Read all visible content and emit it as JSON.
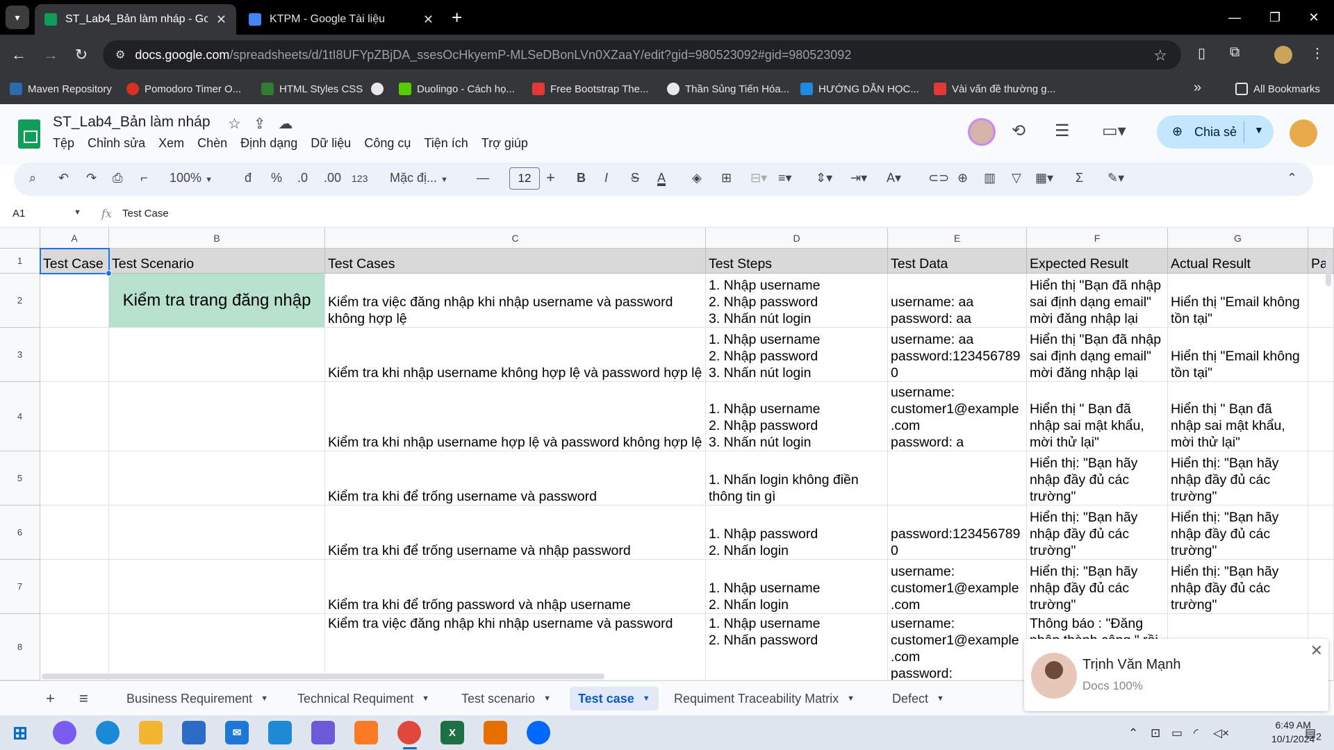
{
  "browser": {
    "tabs": [
      {
        "title": "ST_Lab4_Bản làm nháp - Google",
        "active": true
      },
      {
        "title": "KTPM - Google Tài liệu",
        "active": false
      }
    ],
    "url_host": "docs.google.com",
    "url_path": "/spreadsheets/d/1tI8UFYpZBjDA_ssesOcHkyemP-MLSeDBonLVn0XZaaY/edit?gid=980523092#gid=980523092",
    "bookmarks": [
      "Maven Repository",
      "Pomodoro Timer O...",
      "HTML Styles CSS",
      "",
      "Duolingo - Cách họ...",
      "Free Bootstrap The...",
      "Thần Sủng Tiến Hóa...",
      "HƯỚNG DẪN HỌC...",
      "Vài vấn đề thường g..."
    ],
    "all_bookmarks": "All Bookmarks",
    "more_bookmarks": "»"
  },
  "sheets": {
    "doc_title": "ST_Lab4_Bản làm nháp",
    "menus": [
      "Tệp",
      "Chỉnh sửa",
      "Xem",
      "Chèn",
      "Định dạng",
      "Dữ liệu",
      "Công cụ",
      "Tiện ích",
      "Trợ giúp"
    ],
    "share_label": "Chia sẻ",
    "toolbar": {
      "zoom": "100%",
      "currency": "đ",
      "percent": "%",
      "dec_decrease": ".0",
      "dec_increase": ".00",
      "number_format": "123",
      "font": "Mặc đị...",
      "font_size": "12",
      "bold": "B",
      "italic": "I",
      "strike": "S",
      "text_color": "A"
    },
    "name_box": "A1",
    "formula_value": "Test Case"
  },
  "grid": {
    "columns": [
      "A",
      "B",
      "C",
      "D",
      "E",
      "F",
      "G"
    ],
    "rows": [
      "1",
      "2",
      "3",
      "4",
      "5",
      "6",
      "7",
      "8"
    ],
    "header": [
      "Test Case",
      "Test Scenario",
      "Test Cases",
      "Test Steps",
      "Test Data",
      "Expected Result",
      "Actual Result",
      "Pa"
    ],
    "scenario": "Kiểm tra trang đăng nhập",
    "data_rows": [
      {
        "test_case": "Kiểm tra việc đăng nhập khi nhập username và password không hợp lệ",
        "steps": "1. Nhập username\n2. Nhập password\n3. Nhấn nút login",
        "data": "username: aa\npassword: aa",
        "expected": "Hiển thị \"Bạn đã nhập sai định dạng email\" mời đăng nhập lại",
        "actual": "Hiển thị \"Email không tồn tại\""
      },
      {
        "test_case": "Kiểm tra khi nhập username không hợp lệ và password hợp lệ",
        "steps": "1. Nhập username\n2. Nhập password\n3. Nhấn nút login",
        "data": "username: aa\npassword:123456789\n0",
        "expected": "Hiển thị \"Bạn đã nhập sai định dạng email\" mời đăng nhập lại",
        "actual": "Hiển thị \"Email không tồn tại\""
      },
      {
        "test_case": "Kiểm tra khi nhập username hợp lệ và password không hợp lệ",
        "steps": "1. Nhập username\n2. Nhập password\n3. Nhấn nút login",
        "data": "username:\ncustomer1@example\n.com\npassword: a",
        "expected": "Hiển thị \" Bạn đã nhập sai mật khẩu, mời thử lại\"",
        "actual": "Hiển thị \" Bạn đã nhập sai mật khẩu, mời thử lại\""
      },
      {
        "test_case": "Kiểm tra khi để trống username và password",
        "steps": "1. Nhấn login không điền thông tin gì",
        "data": "",
        "expected": "Hiển thị: \"Bạn hãy nhập đầy đủ các trường\"",
        "actual": "Hiển thị: \"Bạn hãy nhập đầy đủ các trường\""
      },
      {
        "test_case": "Kiểm tra khi để trống username và nhập password",
        "steps": "1. Nhập password\n2. Nhấn login",
        "data": "password:123456789\n0",
        "expected": "Hiển thị: \"Bạn hãy nhập đầy đủ các trường\"",
        "actual": "Hiển thị: \"Bạn hãy nhập đầy đủ các trường\""
      },
      {
        "test_case": "Kiểm tra khi để trống password và nhập username",
        "steps": "1. Nhập username\n2. Nhấn login",
        "data": "username:\ncustomer1@example\n.com",
        "expected": "Hiển thị: \"Bạn hãy nhập đầy đủ các trường\"",
        "actual": "Hiển thị: \"Bạn hãy nhập đầy đủ các trường\""
      },
      {
        "test_case": "Kiểm tra việc đăng nhập khi nhập username và password",
        "steps": "1. Nhập username\n2. Nhấn password",
        "data": "username:\ncustomer1@example\n.com\npassword:",
        "expected": "Thông báo : \"Đăng nhập thành công \" rồi",
        "actual": ""
      }
    ]
  },
  "sheet_tabs": [
    {
      "label": "Business Requirement",
      "active": false
    },
    {
      "label": "Technical Requiment",
      "active": false
    },
    {
      "label": "Test scenario",
      "active": false
    },
    {
      "label": "Test case",
      "active": true
    },
    {
      "label": "Requiment Traceability Matrix",
      "active": false
    },
    {
      "label": "Defect",
      "active": false
    }
  ],
  "notification": {
    "name": "Trịnh Văn Mạnh",
    "subtitle": "Docs 100%"
  },
  "taskbar": {
    "time": "6:49 AM",
    "date": "10/1/2024",
    "notification_count": "2"
  }
}
